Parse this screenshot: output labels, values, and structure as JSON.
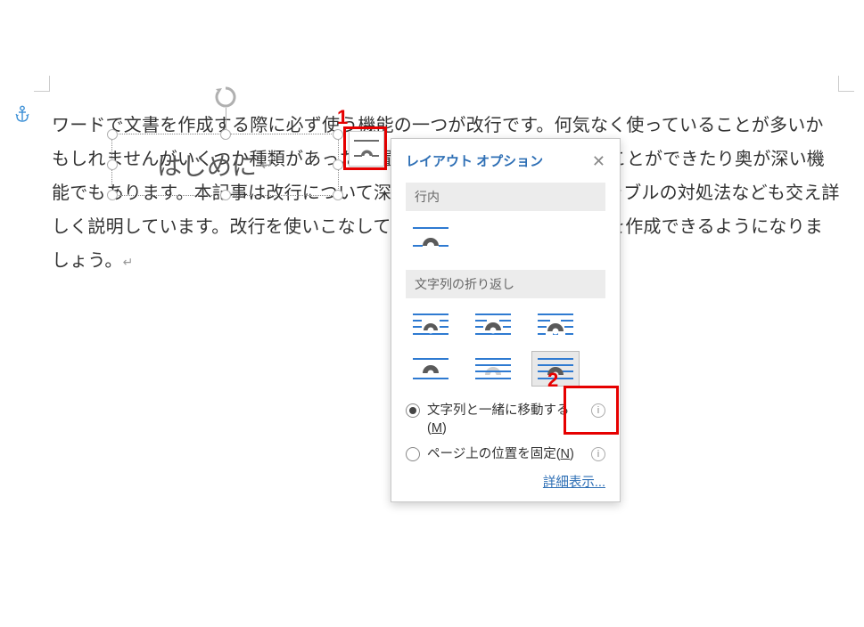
{
  "document": {
    "body_text": "ワードで文書を作成する際に必ず使う機能の一つが改行です。何気なく使っていることが多いかもしれませんがいくつか種類があったり置換を使って一括で削除することができたり奥が深い機能でもあります。本記事は改行について深掘りしています。様々なトラブルの対処法なども交え詳しく説明しています。改行を使いこなしてワンランク上のワード文書を作成できるようになりましょう。",
    "textbox_text": "はじめに"
  },
  "layout_button_tooltip": "レイアウト オプション",
  "popup": {
    "title": "レイアウト オプション",
    "sections": {
      "inline": "行内",
      "wrap": "文字列の折り返し"
    },
    "radios": {
      "move_with_text": "文字列と一緒に移動する(",
      "move_with_text_key": "M",
      "move_with_text_suffix": ")",
      "fix_position": "ページ上の位置を固定(",
      "fix_position_key": "N",
      "fix_position_suffix": ")"
    },
    "footer_link": "詳細表示...",
    "info_glyph": "i"
  },
  "annotations": {
    "a1": "1",
    "a2": "2"
  },
  "icons": {
    "anchor": "⚓",
    "para_mark": "↵",
    "close": "✕"
  }
}
